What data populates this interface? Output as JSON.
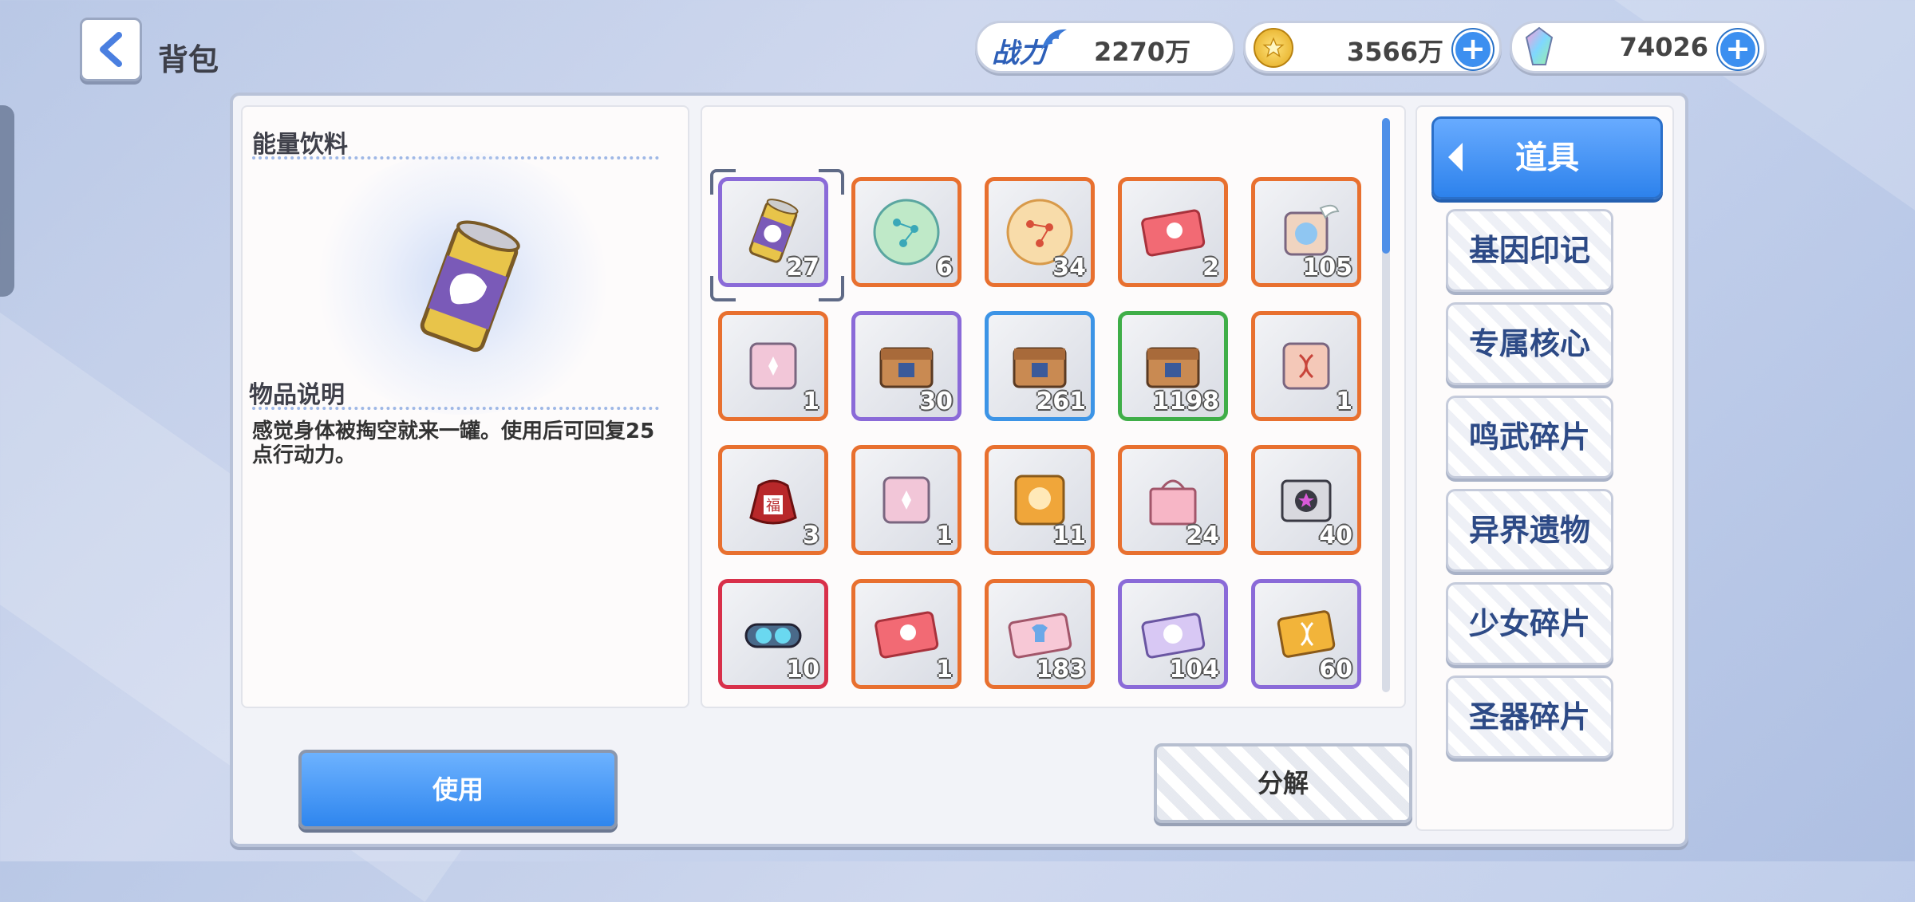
{
  "header": {
    "title": "背包"
  },
  "resources": {
    "power": {
      "label": "战力",
      "value": "2270万"
    },
    "gold": {
      "value": "3566万"
    },
    "gems": {
      "value": "74026"
    }
  },
  "detail": {
    "item_name": "能量饮料",
    "desc_header": "物品说明",
    "description": "感觉身体被掏空就来一罐。使用后可回复25点行动力。"
  },
  "items": [
    {
      "icon": "energy-drink-icon",
      "count": "27",
      "frame": "#8a6ad8"
    },
    {
      "icon": "green-orb-icon",
      "count": "6",
      "frame": "#e8702f"
    },
    {
      "icon": "gold-orb-icon",
      "count": "34",
      "frame": "#e8702f"
    },
    {
      "icon": "red-ticket-icon",
      "count": "2",
      "frame": "#e8702f"
    },
    {
      "icon": "winged-cube-icon",
      "count": "105",
      "frame": "#e8702f"
    },
    {
      "icon": "pink-cube-icon",
      "count": "1",
      "frame": "#e8702f"
    },
    {
      "icon": "chest-icon",
      "count": "30",
      "frame": "#8a6ad8"
    },
    {
      "icon": "chest-icon",
      "count": "261",
      "frame": "#3c94e6"
    },
    {
      "icon": "chest-icon",
      "count": "1198",
      "frame": "#3fae48"
    },
    {
      "icon": "dna-cube-icon",
      "count": "1",
      "frame": "#e8702f"
    },
    {
      "icon": "lucky-bag-icon",
      "count": "3",
      "frame": "#e8702f"
    },
    {
      "icon": "pink-cube-icon",
      "count": "1",
      "frame": "#e8702f"
    },
    {
      "icon": "gold-cube-icon",
      "count": "11",
      "frame": "#e8702f"
    },
    {
      "icon": "gift-box-icon",
      "count": "24",
      "frame": "#e8702f"
    },
    {
      "icon": "star-box-icon",
      "count": "40",
      "frame": "#e8702f"
    },
    {
      "icon": "goggles-icon",
      "count": "10",
      "frame": "#d8304a"
    },
    {
      "icon": "red-ticket-icon",
      "count": "1",
      "frame": "#e8702f"
    },
    {
      "icon": "shirt-ticket-icon",
      "count": "183",
      "frame": "#e8702f"
    },
    {
      "icon": "smile-ticket-icon",
      "count": "104",
      "frame": "#8a6ad8"
    },
    {
      "icon": "dna-card-icon",
      "count": "60",
      "frame": "#8a6ad8"
    }
  ],
  "categories": {
    "active": "道具",
    "list": [
      "基因印记",
      "专属核心",
      "鸣武碎片",
      "异界遗物",
      "少女碎片",
      "圣器碎片"
    ]
  },
  "buttons": {
    "use": "使用",
    "decompose": "分解"
  }
}
